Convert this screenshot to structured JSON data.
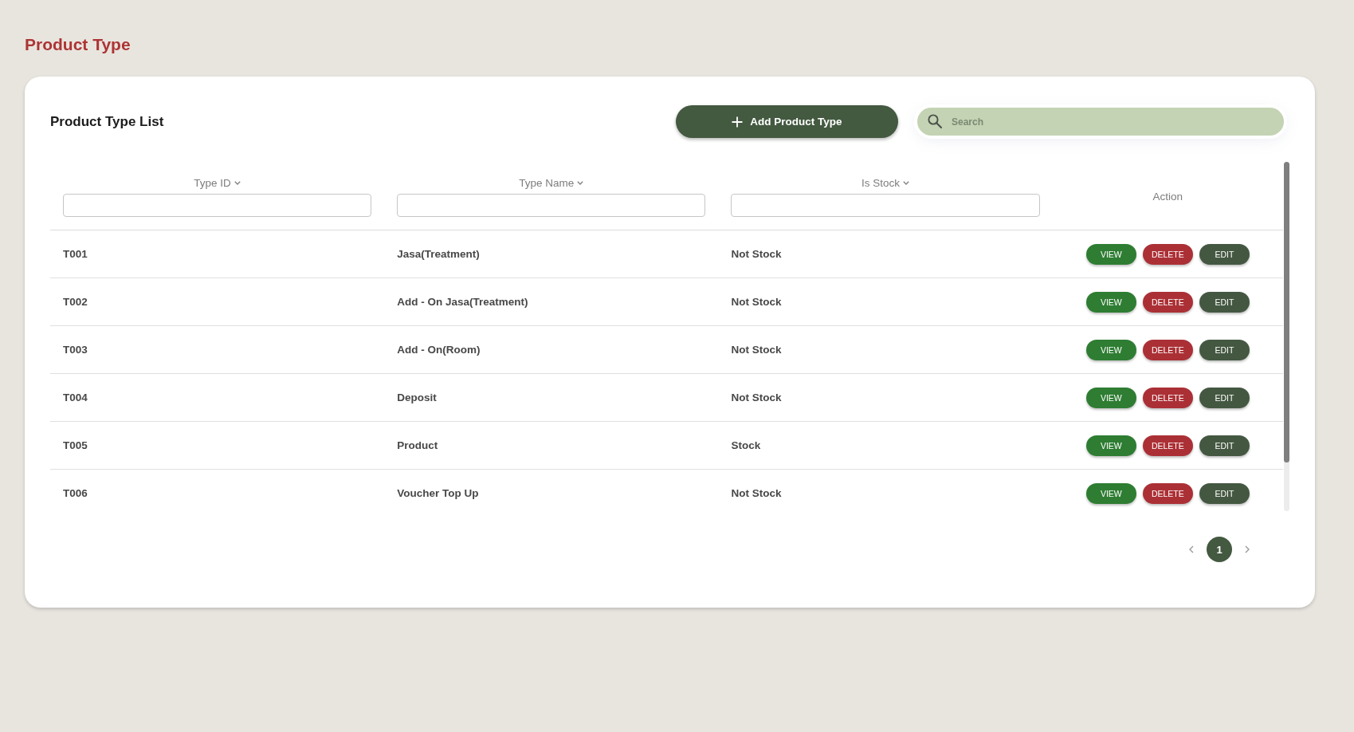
{
  "page_title": "Product Type",
  "card": {
    "title": "Product Type List",
    "add_button": {
      "label": "Add Product Type"
    },
    "search": {
      "placeholder": "Search"
    }
  },
  "table": {
    "columns": [
      {
        "label": "Type ID",
        "kind": "filter"
      },
      {
        "label": "Type Name",
        "kind": "filter"
      },
      {
        "label": "Is Stock",
        "kind": "filter"
      },
      {
        "label": "Action",
        "kind": "plain"
      }
    ],
    "rows": [
      {
        "cells": [
          "T001",
          "Jasa(Treatment)",
          "Not Stock"
        ],
        "actions": [
          {
            "label": "VIEW",
            "kind": "view"
          },
          {
            "label": "DELETE",
            "kind": "delete"
          },
          {
            "label": "EDIT",
            "kind": "edit"
          }
        ]
      },
      {
        "cells": [
          "T002",
          "Add - On Jasa(Treatment)",
          "Not Stock"
        ],
        "actions": [
          {
            "label": "VIEW",
            "kind": "view"
          },
          {
            "label": "DELETE",
            "kind": "delete"
          },
          {
            "label": "EDIT",
            "kind": "edit"
          }
        ]
      },
      {
        "cells": [
          "T003",
          "Add - On(Room)",
          "Not Stock"
        ],
        "actions": [
          {
            "label": "VIEW",
            "kind": "view"
          },
          {
            "label": "DELETE",
            "kind": "delete"
          },
          {
            "label": "EDIT",
            "kind": "edit"
          }
        ]
      },
      {
        "cells": [
          "T004",
          "Deposit",
          "Not Stock"
        ],
        "actions": [
          {
            "label": "VIEW",
            "kind": "view"
          },
          {
            "label": "DELETE",
            "kind": "delete"
          },
          {
            "label": "EDIT",
            "kind": "edit"
          }
        ]
      },
      {
        "cells": [
          "T005",
          "Product",
          "Stock"
        ],
        "actions": [
          {
            "label": "VIEW",
            "kind": "view"
          },
          {
            "label": "DELETE",
            "kind": "delete"
          },
          {
            "label": "EDIT",
            "kind": "edit"
          }
        ]
      },
      {
        "cells": [
          "T006",
          "Voucher Top Up",
          "Not Stock"
        ],
        "actions": [
          {
            "label": "VIEW",
            "kind": "view"
          },
          {
            "label": "DELETE",
            "kind": "delete"
          },
          {
            "label": "EDIT",
            "kind": "edit"
          }
        ]
      }
    ]
  },
  "pagination": {
    "pages": [
      {
        "label": "1",
        "selected": true
      }
    ]
  }
}
